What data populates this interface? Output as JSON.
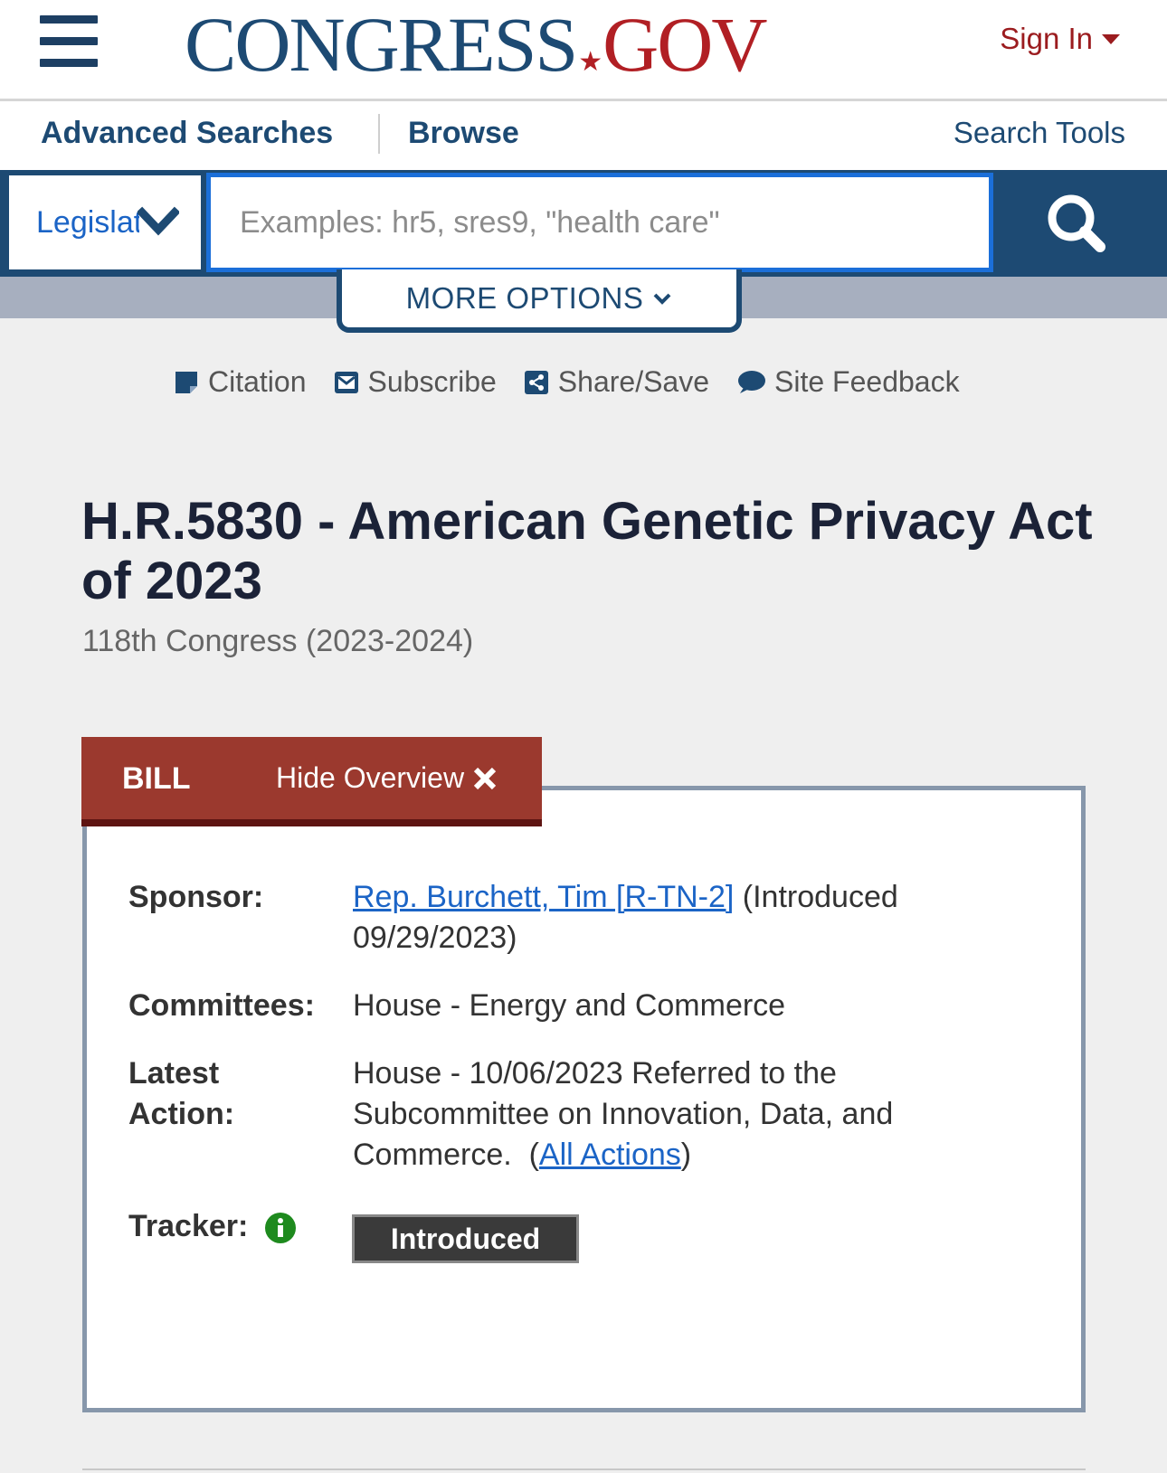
{
  "header": {
    "logo_congress": "CONGRESS",
    "logo_star": "★",
    "logo_gov": "GOV",
    "sign_in": "Sign In"
  },
  "subnav": {
    "advanced_searches": "Advanced Searches",
    "browse": "Browse",
    "search_tools": "Search Tools"
  },
  "search": {
    "scope_value": "Legislation",
    "placeholder": "Examples: hr5, sres9, \"health care\"",
    "more_options": "MORE OPTIONS"
  },
  "utilities": [
    {
      "label": "Citation",
      "icon": "citation-icon"
    },
    {
      "label": "Subscribe",
      "icon": "envelope-icon"
    },
    {
      "label": "Share/Save",
      "icon": "share-icon"
    },
    {
      "label": "Site Feedback",
      "icon": "speech-bubble-icon"
    }
  ],
  "bill": {
    "title": "H.R.5830 - American Genetic Privacy Act of 2023",
    "congress": "118th Congress (2023-2024)",
    "tab_label": "BILL",
    "hide_overview": "Hide Overview",
    "sponsor_label": "Sponsor:",
    "sponsor_link": "Rep. Burchett, Tim [R-TN-2]",
    "sponsor_text": " (Introduced 09/29/2023)",
    "committees_label": "Committees:",
    "committees_value": "House - Energy and Commerce",
    "latest_action_label": "Latest Action:",
    "latest_action_text": "House - 10/06/2023 Referred to the Subcommittee on Innovation, Data, and Commerce.  (",
    "all_actions_link": "All Actions",
    "latest_action_close": ")",
    "tracker_label": "Tracker:",
    "tracker_status": "Introduced"
  },
  "colors": {
    "navy": "#1d4a73",
    "red": "#b11f24",
    "tab_red": "#9b392e",
    "link_blue": "#1b64c6",
    "info_green": "#1e8a1e"
  }
}
